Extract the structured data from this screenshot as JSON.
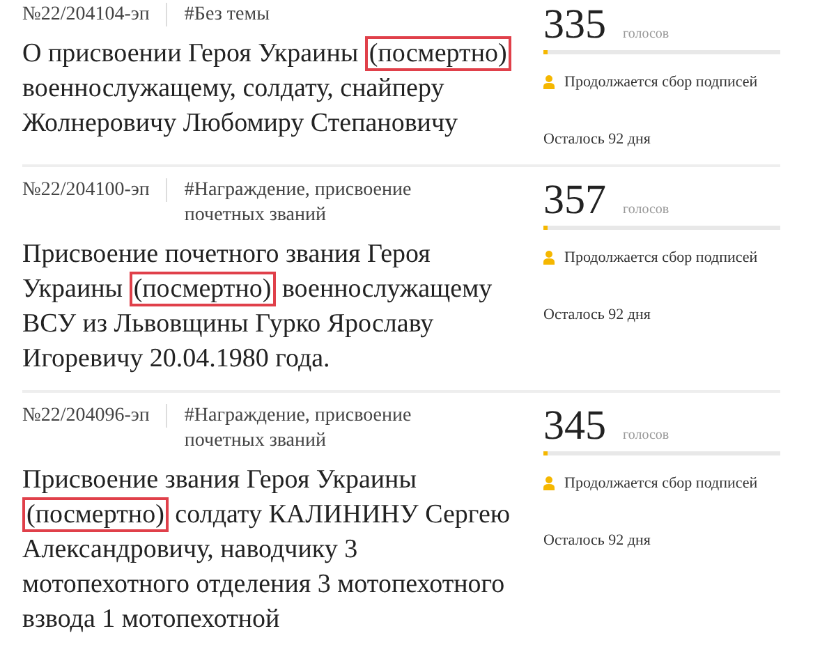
{
  "petitions": [
    {
      "number": "№22/204104-эп",
      "tag": "#Без темы",
      "title_before": "О присвоении Героя Украины ",
      "highlight": "(посмертно)",
      "title_after": " военнослужащему, солдату, снайперу Жолнеровичу Любомиру Степановичу",
      "votes": "335",
      "votes_label": "голосов",
      "level": 0.02,
      "status": "Продолжается сбор подписей",
      "remaining": "Осталось 92 дня"
    },
    {
      "number": "№22/204100-эп",
      "tag": "#Награждение, присвоение почетных званий",
      "title_before": "Присвоение почетного звания Героя Украины ",
      "highlight": "(посмертно)",
      "title_after": " военнослужащему ВСУ из Львовщины Гурко Ярославу Игоревичу 20.04.1980 года.",
      "votes": "357",
      "votes_label": "голосов",
      "level": 0.02,
      "status": "Продолжается сбор подписей",
      "remaining": "Осталось 92 дня"
    },
    {
      "number": "№22/204096-эп",
      "tag": "#Награждение, присвоение почетных званий",
      "title_before": "Присвоение звания Героя Украины ",
      "highlight": "(посмертно)",
      "title_after": " солдату КАЛИНИНУ Сергею Александровичу, наводчику 3 мотопехотного отделения 3 мотопехотного взвода 1 мотопехотной",
      "votes": "345",
      "votes_label": "голосов",
      "level": 0.02,
      "status": "Продолжается сбор подписей",
      "remaining": "Осталось 92 дня"
    }
  ]
}
